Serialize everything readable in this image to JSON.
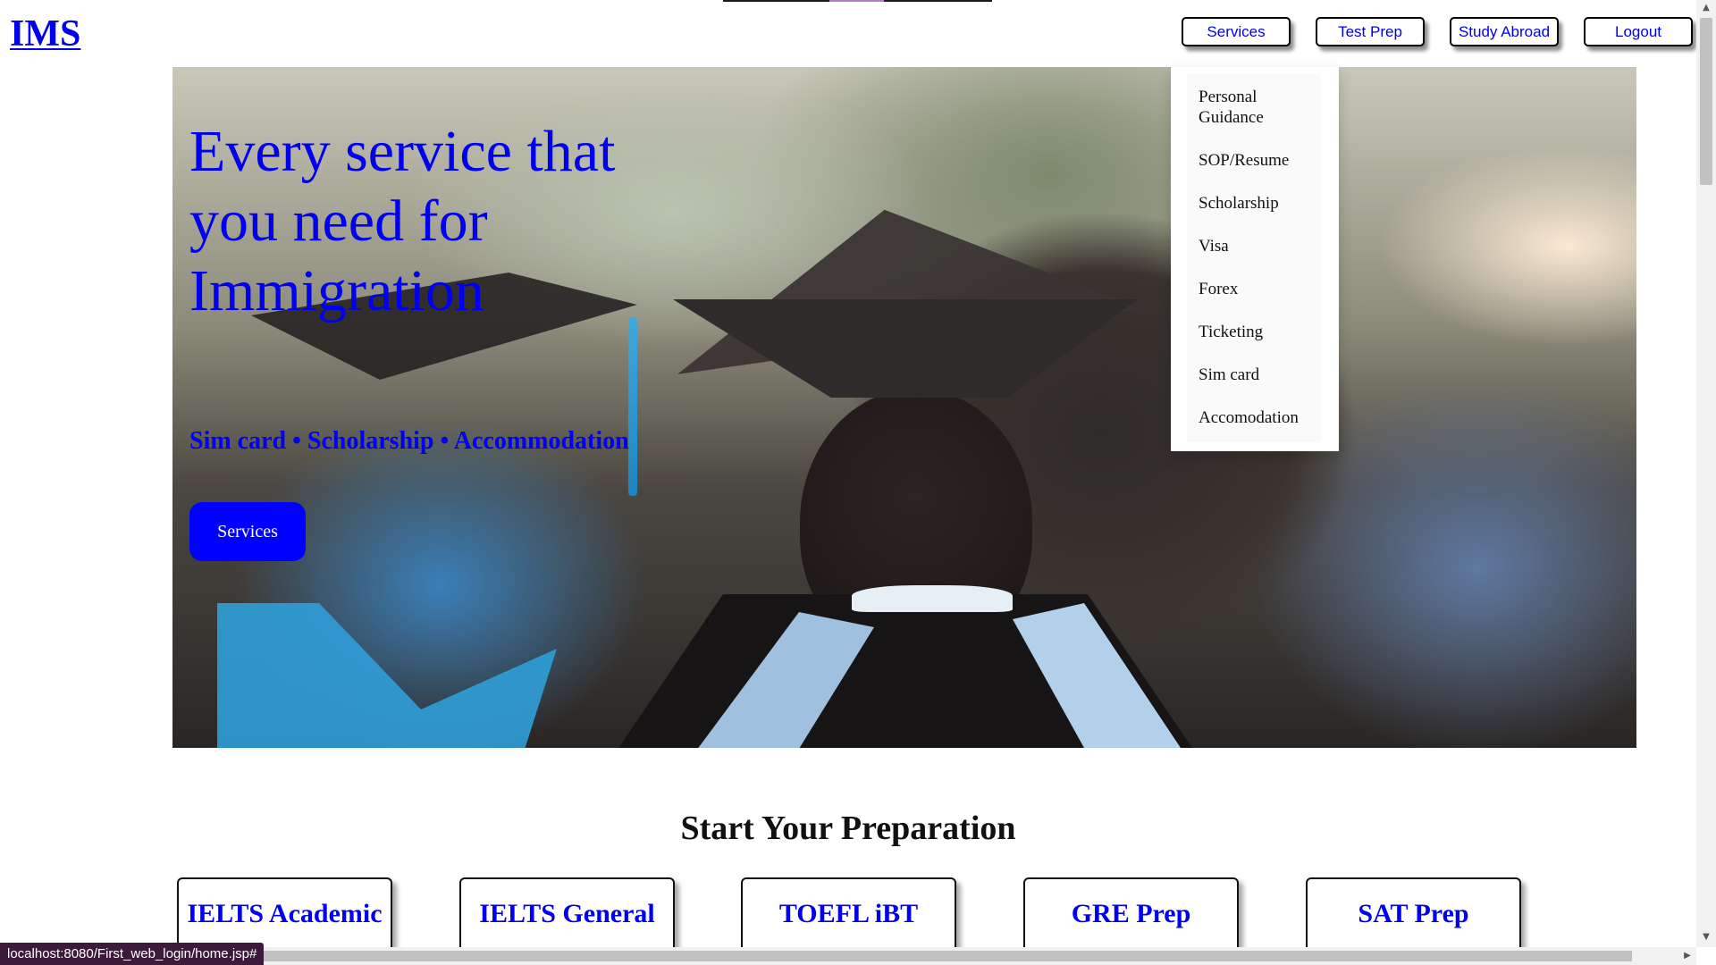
{
  "brand": {
    "logo": "IMS"
  },
  "nav": {
    "items": [
      {
        "label": "Services"
      },
      {
        "label": "Test Prep"
      },
      {
        "label": "Study Abroad"
      },
      {
        "label": "Logout"
      }
    ]
  },
  "services_dropdown": {
    "items": [
      {
        "label": "Personal Guidance"
      },
      {
        "label": "SOP/Resume"
      },
      {
        "label": "Scholarship"
      },
      {
        "label": "Visa"
      },
      {
        "label": "Forex"
      },
      {
        "label": "Ticketing"
      },
      {
        "label": "Sim card"
      },
      {
        "label": "Accomodation"
      }
    ]
  },
  "hero": {
    "title": "Every service that you need for Immigration",
    "tagline": "Sim card • Scholarship • Accommodation",
    "button_label": "Services"
  },
  "prep_section": {
    "title": "Start Your Preparation",
    "cards": [
      {
        "label": "IELTS Academic"
      },
      {
        "label": "IELTS General"
      },
      {
        "label": "TOEFL iBT"
      },
      {
        "label": "GRE Prep"
      },
      {
        "label": "SAT Prep"
      }
    ]
  },
  "status_bar": {
    "url": "localhost:8080/First_web_login/home.jsp#"
  },
  "icons": {
    "scroll_up": "triangle-up-icon",
    "scroll_down": "triangle-down-icon",
    "scroll_right": "triangle-right-icon"
  },
  "colors": {
    "link_blue": "#0000ee",
    "button_blue": "#0000ff",
    "status_bg": "#3b1a3a"
  }
}
